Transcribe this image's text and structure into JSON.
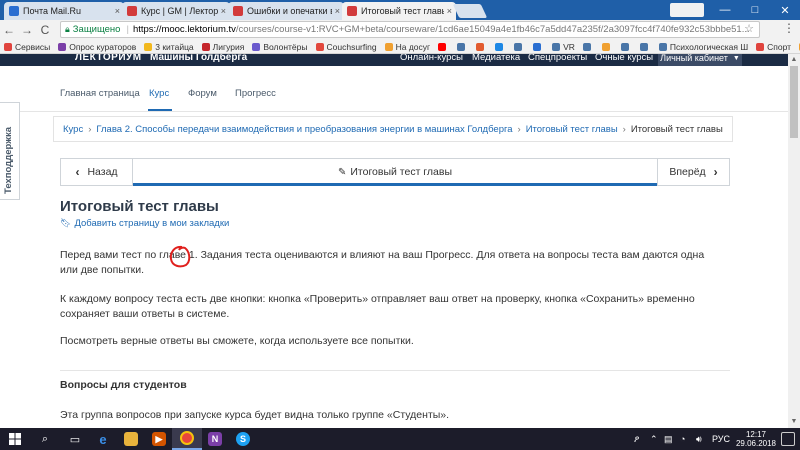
{
  "browser": {
    "tabs": [
      {
        "title": "Почта Mail.Ru",
        "color": "#2a6ed1"
      },
      {
        "title": "Курс | GM | Лекториум",
        "color": "#d23b3b"
      },
      {
        "title": "Ошибки и опечатки в те",
        "color": "#d23b3b"
      },
      {
        "title": "Итоговый тест главы | И",
        "color": "#d23b3b"
      }
    ],
    "close_glyph": "×",
    "window_controls": {
      "minimize": "—",
      "maximize": "□",
      "close": "✕"
    },
    "nav": {
      "back": "←",
      "forward": "→",
      "reload": "C"
    },
    "address": {
      "secure_label": "Защищено",
      "host": "https://mooc.lektorium.tv",
      "path": "/courses/course-v1:RVC+GM+beta/courseware/1cd6ae15049a4e1fb46c7a5dd47a235f/2a3097fcc4f740fe932c53bbbe51..."
    },
    "bookmarks": [
      {
        "label": "Сервисы",
        "color": "#e0443e"
      },
      {
        "label": "Опрос кураторов",
        "color": "#7b3fa8"
      },
      {
        "label": "3 китайца",
        "color": "#f2b81d"
      },
      {
        "label": "Лигурия",
        "color": "#c5252b"
      },
      {
        "label": "Волонтёры",
        "color": "#6a5acd"
      },
      {
        "label": "Couchsurfing",
        "color": "#e2483d"
      },
      {
        "label": "На досуг",
        "color": "#f0a030"
      },
      {
        "label": "",
        "color": "#ff0000"
      },
      {
        "label": "",
        "color": "#4a76a8"
      },
      {
        "label": "",
        "color": "#e25b2f"
      },
      {
        "label": "",
        "color": "#1e88e5"
      },
      {
        "label": "",
        "color": "#4a76a8"
      },
      {
        "label": "",
        "color": "#2a6ed1"
      },
      {
        "label": "VR",
        "color": "#4a76a8"
      },
      {
        "label": "",
        "color": "#4a76a8"
      },
      {
        "label": "",
        "color": "#f0a030"
      },
      {
        "label": "",
        "color": "#4a76a8"
      },
      {
        "label": "",
        "color": "#4a76a8"
      },
      {
        "label": "Психологическая Ш",
        "color": "#4a76a8"
      },
      {
        "label": "Спорт",
        "color": "#e0443e"
      },
      {
        "label": "Актив",
        "color": "#f0a030"
      }
    ]
  },
  "site": {
    "logo": "ЛЕКТОРИУМ",
    "course_name": "Машины Голдберга",
    "nav": [
      "Онлайн-курсы",
      "Медиатека",
      "Спецпроекты",
      "Очные курсы"
    ],
    "cabinet": "Личный кабинет"
  },
  "course_tabs": [
    {
      "label": "Главная страница",
      "active": false
    },
    {
      "label": "Курс",
      "active": true
    },
    {
      "label": "Форум",
      "active": false
    },
    {
      "label": "Прогресс",
      "active": false
    }
  ],
  "breadcrumb": {
    "links": [
      "Курс",
      "Глава 2. Способы передачи взаимодействия и преобразования энергии в машинах Голдберга",
      "Итоговый тест главы"
    ],
    "separator": "›",
    "current": "Итоговый тест главы"
  },
  "sequence": {
    "prev": "Назад",
    "next": "Вперёд",
    "current": "Итоговый тест главы"
  },
  "content": {
    "title": "Итоговый тест главы",
    "bookmark": "Добавить страницу в мои закладки",
    "para1": "Перед вами тест по главе 1. Задания теста оцениваются и влияют на ваш Прогресс. Для ответа на вопросы теста вам даются одна или две попытки.",
    "para2": "К каждому вопросу теста есть две кнопки: кнопка «Проверить» отправляет ваш ответ на проверку, кнопка «Сохранить» временно сохраняет ваши ответы в системе.",
    "para3": "Посмотреть верные ответы вы сможете, когда используете все попытки.",
    "section_title": "Вопросы для студентов",
    "para4": "Эта группа вопросов при запуске курса будет видна только группе «Студенты»."
  },
  "help_tab": "Техподдержка",
  "taskbar": {
    "tray_lang": "РУС",
    "time": "12:17",
    "date": "29.06.2018"
  }
}
